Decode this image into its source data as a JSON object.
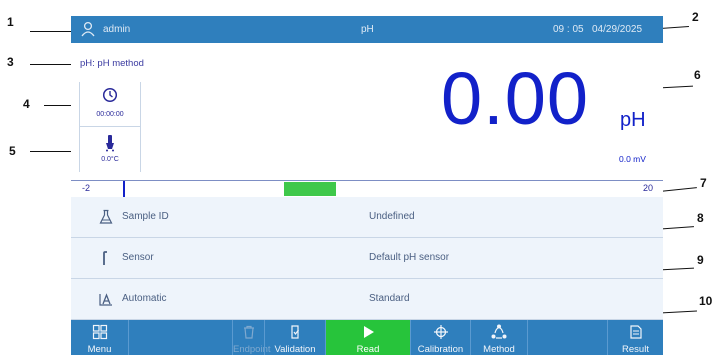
{
  "callouts": [
    "1",
    "2",
    "3",
    "4",
    "5",
    "6",
    "7",
    "8",
    "9",
    "10"
  ],
  "topbar": {
    "user": "admin",
    "title": "pH",
    "time": "09 : 05",
    "date": "04/29/2025"
  },
  "method": {
    "label": "pH: pH method"
  },
  "status": {
    "timer": "00:00:00",
    "temperature": "0.0°C"
  },
  "reading": {
    "value": "0.00",
    "unit": "pH",
    "mv": "0.0 mV"
  },
  "range": {
    "min": "-2",
    "max": "20",
    "marker_value": -0.2,
    "window_from": 6.1,
    "window_to": 8.4,
    "marker_color": "#1221c9",
    "window_color": "#3fc84a"
  },
  "rows": [
    {
      "label": "Sample ID",
      "value": "Undefined",
      "icon": "flask-icon"
    },
    {
      "label": "Sensor",
      "value": "Default pH sensor",
      "icon": "sensor-probe-icon"
    },
    {
      "label": "Automatic",
      "value": "Standard",
      "icon": "auto-endpoint-icon"
    }
  ],
  "toolbar": {
    "menu": "Menu",
    "endpoint": "Endpoint",
    "validation": "Validation",
    "read": "Read",
    "calibration": "Calibration",
    "method": "Method",
    "result": "Result"
  },
  "colors": {
    "bar": "#2f7fbd",
    "accent": "#1221c9",
    "active": "#27c43b"
  }
}
